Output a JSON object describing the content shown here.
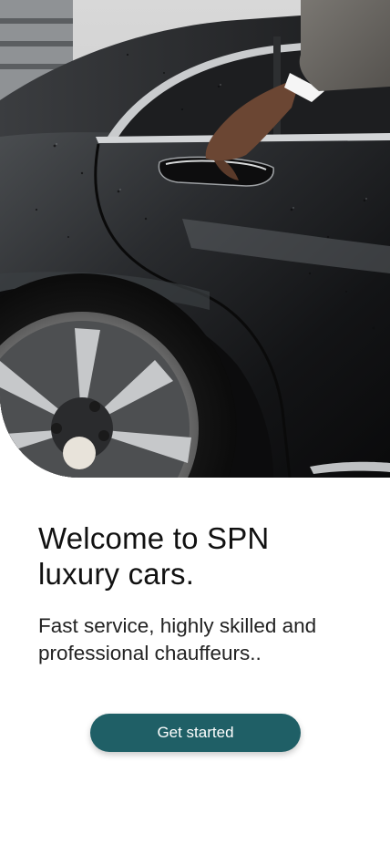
{
  "hero": {
    "image": "black-luxury-car-door-handle-photo"
  },
  "welcome": {
    "title": "Welcome to SPN luxury cars.",
    "subtitle": "Fast service, highly skilled and professional chauffeurs.."
  },
  "cta": {
    "label": "Get started",
    "color": "#1f5f66"
  }
}
